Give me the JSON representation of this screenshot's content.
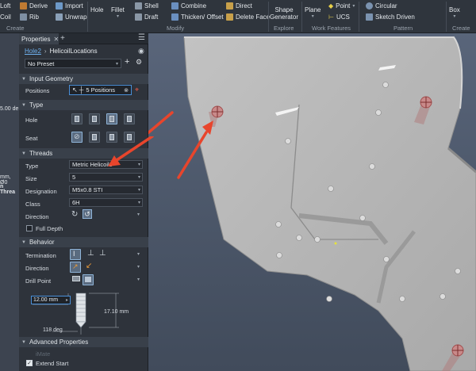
{
  "ribbon": {
    "create": {
      "loft": "Loft",
      "coil": "Coil",
      "derive": "Derive",
      "rib": "Rib",
      "import": "Import",
      "unwrap": "Unwrap",
      "group": "Create"
    },
    "modify": {
      "hole": "Hole",
      "fillet": "Fillet",
      "shell": "Shell",
      "draft": "Draft",
      "combine": "Combine",
      "thicken": "Thicken/ Offset",
      "direct": "Direct",
      "delete_face": "Delete Face",
      "group": "Modify"
    },
    "explore": {
      "shape_generator": "Shape Generator",
      "group": "Explore"
    },
    "work_features": {
      "plane": "Plane",
      "point": "Point",
      "ucs": "UCS",
      "group": "Work Features"
    },
    "pattern": {
      "circular": "Circular",
      "sketch_driven": "Sketch Driven",
      "group": "Pattern"
    },
    "create_freeform": {
      "box": "Box",
      "group": "Create Fr"
    }
  },
  "left_strip": {
    "text1": "5.00 de",
    "text2": "mm, Ø0",
    "text3": "n Threa"
  },
  "panel": {
    "tab": "Properties",
    "breadcrumb_link": "Hole2",
    "breadcrumb_current": "HelicoilLocations",
    "preset": "No Preset",
    "input_geometry": {
      "title": "Input Geometry",
      "positions_label": "Positions",
      "positions_value": "5 Positions"
    },
    "type": {
      "title": "Type",
      "hole_label": "Hole",
      "seat_label": "Seat"
    },
    "threads": {
      "title": "Threads",
      "type_label": "Type",
      "type_value": "Metric Helicoils",
      "size_label": "Size",
      "size_value": "5",
      "designation_label": "Designation",
      "designation_value": "M5x0.8 STI",
      "class_label": "Class",
      "class_value": "6H",
      "direction_label": "Direction",
      "full_depth_label": "Full Depth"
    },
    "behavior": {
      "title": "Behavior",
      "termination_label": "Termination",
      "direction_label": "Direction",
      "drill_point_label": "Drill Point"
    },
    "dims": {
      "diameter": "12.00 mm",
      "depth": "17.10 mm",
      "angle": "118 deg"
    },
    "advanced": {
      "title": "Advanced Properties",
      "istate_label": "iMate",
      "extend_start_label": "Extend Start"
    }
  },
  "colors": {
    "accent": "#4a90d9",
    "arrow": "#e8452c",
    "model": "#b3b3b3"
  }
}
